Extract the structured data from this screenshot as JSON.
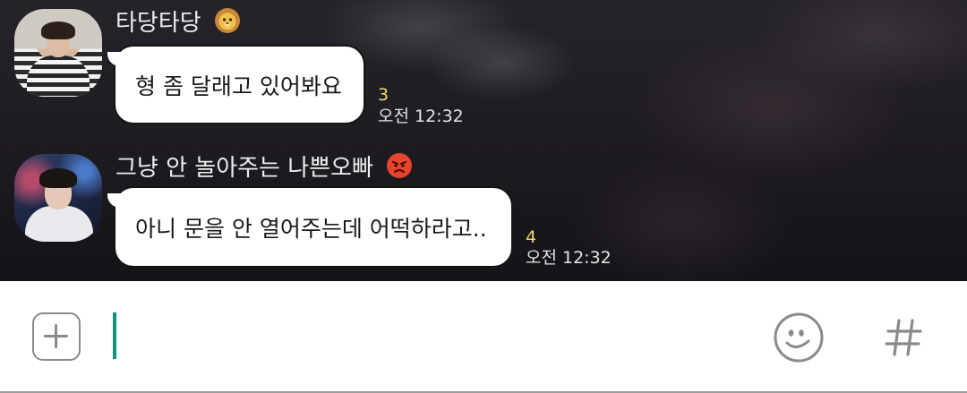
{
  "messages": [
    {
      "sender": "타당타당",
      "sender_emoji": "lion-emoji",
      "text": "형 좀 달래고 있어봐요",
      "unread": "3",
      "time": "오전 12:32"
    },
    {
      "sender": "그냥 안 놀아주는 나쁜오빠",
      "sender_emoji": "angry-face-emoji",
      "text": "아니 문을 안 열어주는데 어떡하라고..",
      "unread": "4",
      "time": "오전 12:32"
    }
  ],
  "input": {
    "value": "",
    "attach_icon": "plus-square-icon",
    "emoji_icon": "smiley-icon",
    "hash_icon": "hash-icon"
  },
  "colors": {
    "cursor": "#12917f",
    "unread": "#f1d86a",
    "bubble": "#ffffff"
  }
}
